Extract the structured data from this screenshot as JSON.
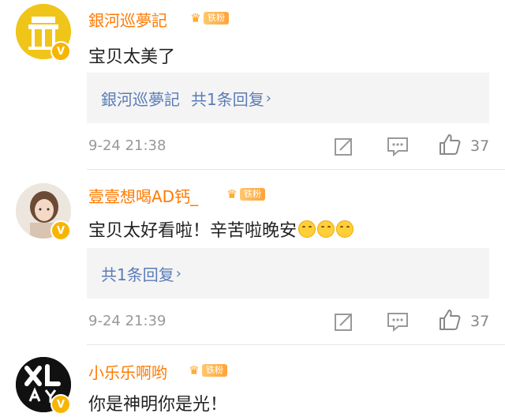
{
  "comments": [
    {
      "username": "銀河巡夢記",
      "badge": "铁粉",
      "content": "宝贝太美了",
      "reply_author": "銀河巡夢記",
      "reply_summary": "共1条回复 ",
      "time": "9-24 21:38",
      "likes": "37"
    },
    {
      "username": "壹壹想喝AD钙_",
      "badge": "铁粉",
      "content": "宝贝太好看啦！辛苦啦晚安",
      "emojis": [
        "smile-emoji",
        "smile-emoji",
        "smile-emoji"
      ],
      "reply_summary": "共1条回复 ",
      "time": "9-24 21:39",
      "likes": "37"
    },
    {
      "username": "小乐乐啊哟",
      "badge": "铁粉",
      "content": "你是神明你是光！"
    }
  ],
  "icons": {
    "repost": "repost-icon",
    "comment": "comment-icon",
    "like": "thumbs-up-icon",
    "verified": "verified-v-icon",
    "crown": "crown-icon",
    "chevron": "chevron-right-icon"
  },
  "colors": {
    "username": "#ff7a00",
    "reply_link": "#5a7cb8",
    "meta": "#999999",
    "verified": "#f7b500",
    "reply_bg": "#f4f4f4"
  }
}
